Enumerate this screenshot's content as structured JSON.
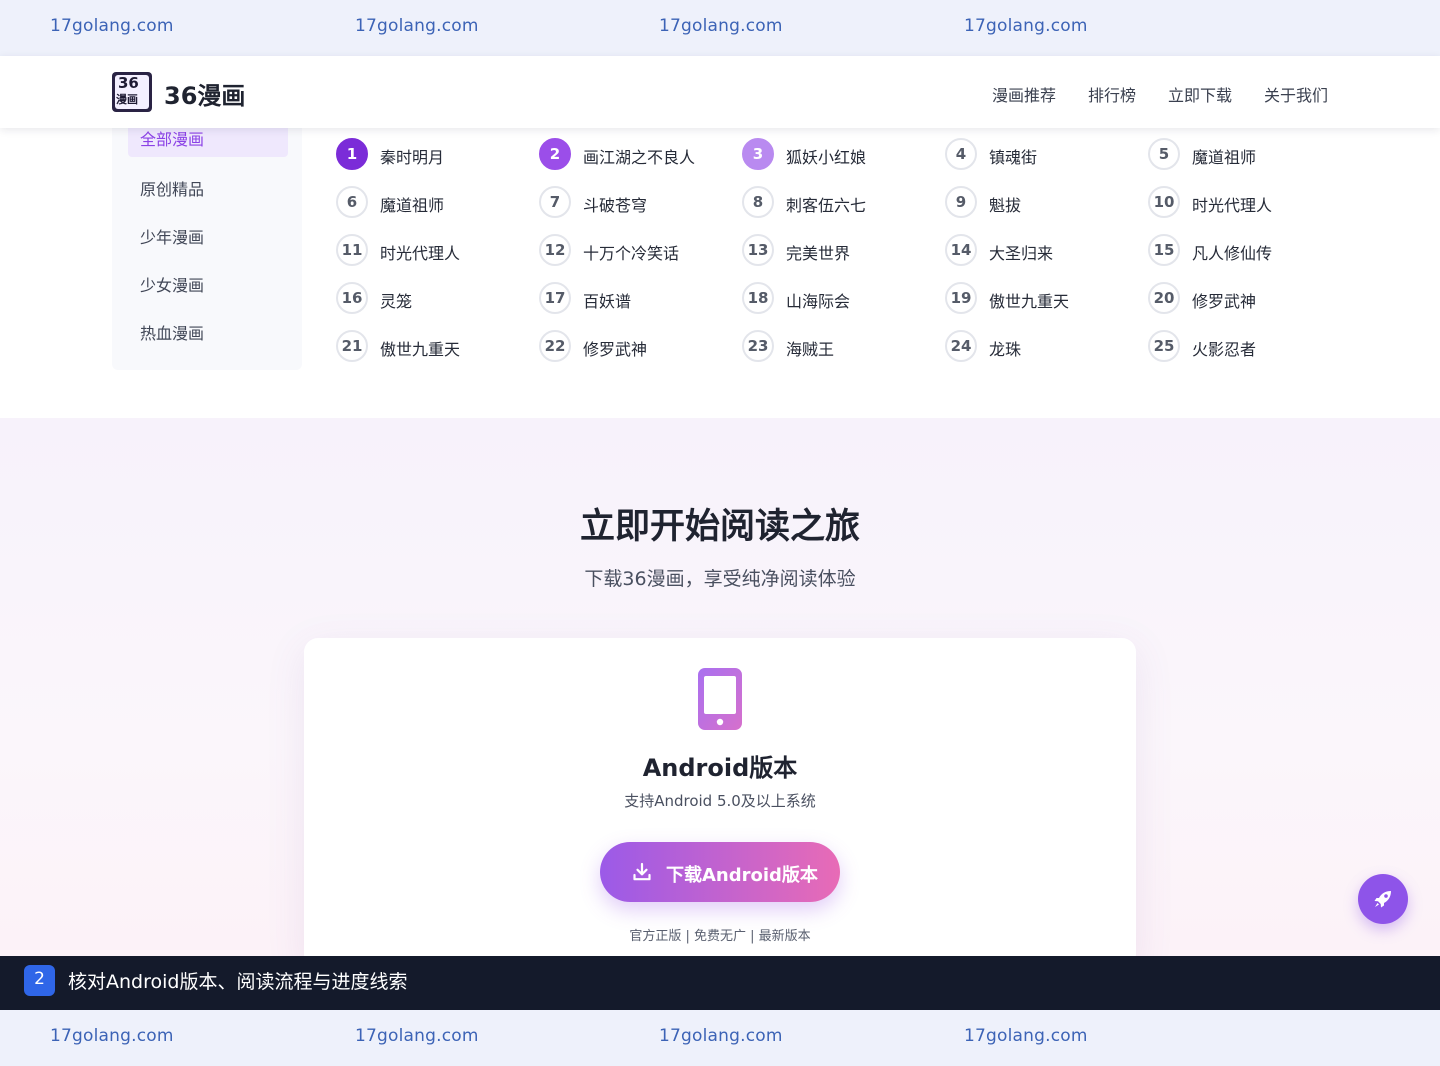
{
  "watermark": {
    "texts": [
      "17golang.com",
      "17golang.com",
      "17golang.com",
      "17golang.com"
    ]
  },
  "navbar": {
    "logo": {
      "number": "36",
      "text": "漫画"
    },
    "brand": "36漫画",
    "links": [
      "漫画推荐",
      "排行榜",
      "立即下载",
      "关于我们"
    ]
  },
  "categories": {
    "items": [
      "全部漫画",
      "原创精品",
      "少年漫画",
      "少女漫画",
      "热血漫画"
    ],
    "active_index": 0
  },
  "ranking": {
    "items": [
      {
        "rank": "1",
        "title": "秦时明月"
      },
      {
        "rank": "2",
        "title": "画江湖之不良人"
      },
      {
        "rank": "3",
        "title": "狐妖小红娘"
      },
      {
        "rank": "4",
        "title": "镇魂街"
      },
      {
        "rank": "5",
        "title": "魔道祖师"
      },
      {
        "rank": "6",
        "title": "魔道祖师"
      },
      {
        "rank": "7",
        "title": "斗破苍穹"
      },
      {
        "rank": "8",
        "title": "刺客伍六七"
      },
      {
        "rank": "9",
        "title": "魁拔"
      },
      {
        "rank": "10",
        "title": "时光代理人"
      },
      {
        "rank": "11",
        "title": "时光代理人"
      },
      {
        "rank": "12",
        "title": "十万个冷笑话"
      },
      {
        "rank": "13",
        "title": "完美世界"
      },
      {
        "rank": "14",
        "title": "大圣归来"
      },
      {
        "rank": "15",
        "title": "凡人修仙传"
      },
      {
        "rank": "16",
        "title": "灵笼"
      },
      {
        "rank": "17",
        "title": "百妖谱"
      },
      {
        "rank": "18",
        "title": "山海际会"
      },
      {
        "rank": "19",
        "title": "傲世九重天"
      },
      {
        "rank": "20",
        "title": "修罗武神"
      },
      {
        "rank": "21",
        "title": "傲世九重天"
      },
      {
        "rank": "22",
        "title": "修罗武神"
      },
      {
        "rank": "23",
        "title": "海贼王"
      },
      {
        "rank": "24",
        "title": "龙珠"
      },
      {
        "rank": "25",
        "title": "火影忍者"
      }
    ]
  },
  "cta": {
    "title": "立即开始阅读之旅",
    "subtitle": "下载36漫画，享受纯净阅读体验",
    "card": {
      "icon": "phone-icon",
      "title": "Android版本",
      "desc": "支持Android 5.0及以上系统",
      "button_label": "下载Android版本",
      "button_icon": "download-icon",
      "note": "官方正版 | 免费无广 | 最新版本"
    }
  },
  "float_button": {
    "icon": "rocket-icon"
  },
  "caption": {
    "badge": "2",
    "text": "核对Android版本、阅读流程与进度线索"
  },
  "colors": {
    "accent": "#8b42e6",
    "rank1": "#7b2cd8",
    "rank2": "#9b4ee9",
    "rank3": "#b98af0",
    "button_gradient_start": "#9b5ae8",
    "button_gradient_end": "#e86bb6",
    "caption_bg": "#141a2b",
    "watermark": "#3c63b6"
  }
}
